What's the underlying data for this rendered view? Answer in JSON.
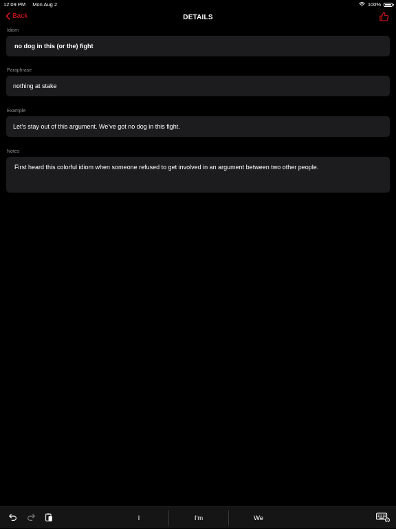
{
  "status_bar": {
    "time": "12:09 PM",
    "date": "Mon Aug 2",
    "battery": "100%",
    "battery_level": 1.0
  },
  "nav": {
    "back_label": "Back",
    "title": "DETAILS",
    "like_icon": "thumbs-up-icon"
  },
  "fields": {
    "idiom": {
      "label": "Idiom",
      "value": "no dog in this (or the) fight"
    },
    "paraphrase": {
      "label": "Paraphrase",
      "value": "nothing at stake"
    },
    "example": {
      "label": "Example",
      "value": "Let’s stay out of this argument. We’ve got no dog in this fight."
    },
    "notes": {
      "label": "Notes",
      "value": "First heard this colorful idiom when someone refused to get involved in an argument between two other people."
    }
  },
  "keyboard_bar": {
    "suggestions": [
      "I",
      "I'm",
      "We"
    ],
    "icons": [
      "undo-icon",
      "redo-icon",
      "paste-icon",
      "keyboard-icon"
    ]
  },
  "colors": {
    "accent": "#e6171a",
    "background": "#000000",
    "field_background": "#1c1c1e",
    "label": "#8e8e93"
  }
}
